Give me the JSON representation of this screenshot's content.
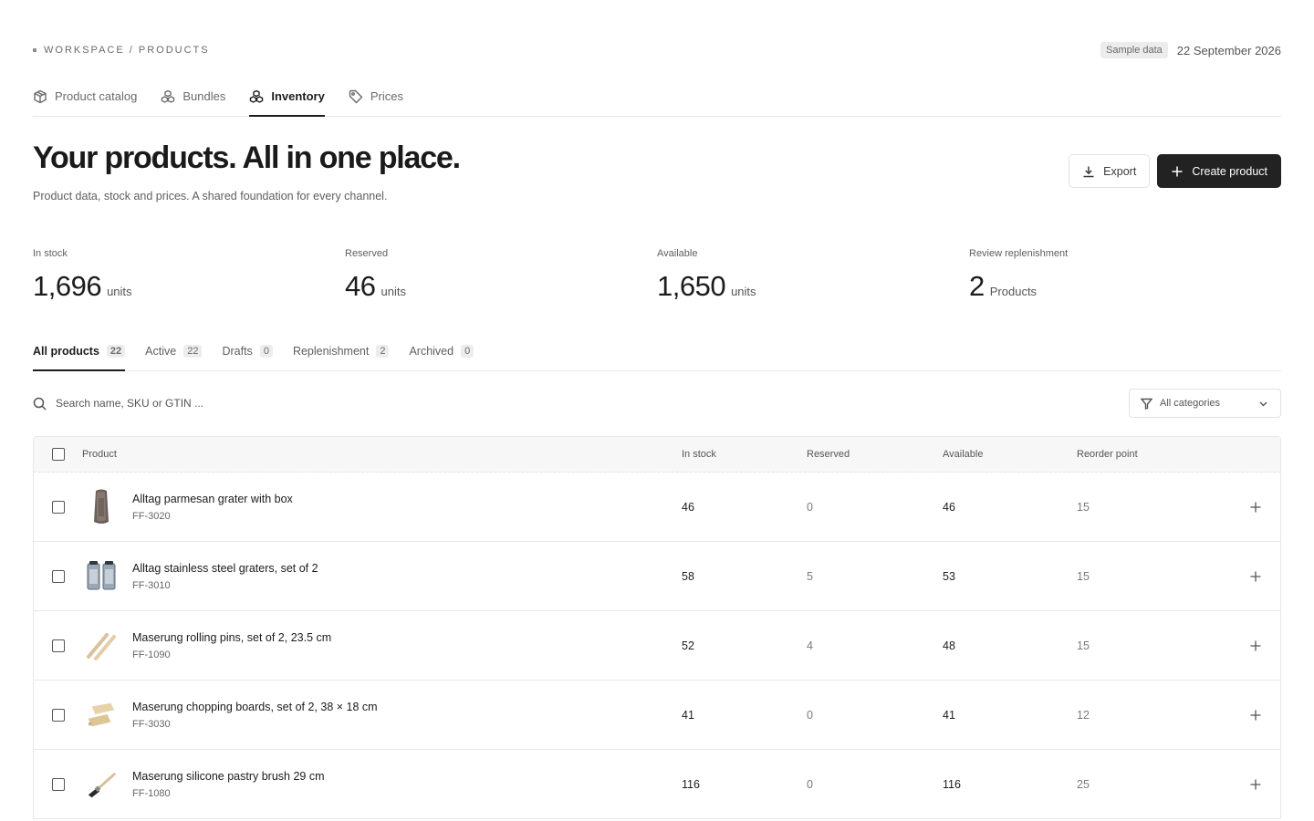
{
  "breadcrumb": {
    "path": "WORKSPACE / PRODUCTS"
  },
  "header": {
    "badge": "Sample data",
    "date": "22 September 2026"
  },
  "nav_tabs": [
    {
      "label": "Product catalog",
      "icon": "box-icon",
      "active": false
    },
    {
      "label": "Bundles",
      "icon": "bundles-icon",
      "active": false
    },
    {
      "label": "Inventory",
      "icon": "inventory-icon",
      "active": true
    },
    {
      "label": "Prices",
      "icon": "tag-icon",
      "active": false
    }
  ],
  "hero": {
    "title": "Your products. All in one place.",
    "subtitle": "Product data, stock and prices. A shared foundation for every channel."
  },
  "actions": {
    "export_label": "Export",
    "create_label": "Create product"
  },
  "stats": [
    {
      "label": "In stock",
      "value": "1,696",
      "unit": "units"
    },
    {
      "label": "Reserved",
      "value": "46",
      "unit": "units"
    },
    {
      "label": "Available",
      "value": "1,650",
      "unit": "units"
    },
    {
      "label": "Review replenishment",
      "value": "2",
      "unit": "Products"
    }
  ],
  "filter_tabs": [
    {
      "label": "All products",
      "count": "22",
      "active": true
    },
    {
      "label": "Active",
      "count": "22",
      "active": false
    },
    {
      "label": "Drafts",
      "count": "0",
      "active": false
    },
    {
      "label": "Replenishment",
      "count": "2",
      "active": false
    },
    {
      "label": "Archived",
      "count": "0",
      "active": false
    }
  ],
  "search": {
    "placeholder": "Search name, SKU or GTIN ..."
  },
  "category_filter": {
    "selected": "All categories"
  },
  "table": {
    "columns": {
      "product": "Product",
      "in_stock": "In stock",
      "reserved": "Reserved",
      "available": "Available",
      "reorder_point": "Reorder point"
    },
    "rows": [
      {
        "name": "Alltag parmesan grater with box",
        "sku": "FF-3020",
        "in_stock": "46",
        "reserved": "0",
        "available": "46",
        "reorder_point": "15",
        "thumb": "grater-box"
      },
      {
        "name": "Alltag stainless steel graters, set of 2",
        "sku": "FF-3010",
        "in_stock": "58",
        "reserved": "5",
        "available": "53",
        "reorder_point": "15",
        "thumb": "graters"
      },
      {
        "name": "Maserung rolling pins, set of 2, 23.5 cm",
        "sku": "FF-1090",
        "in_stock": "52",
        "reserved": "4",
        "available": "48",
        "reorder_point": "15",
        "thumb": "rolling-pins"
      },
      {
        "name": "Maserung chopping boards, set of 2, 38 × 18 cm",
        "sku": "FF-3030",
        "in_stock": "41",
        "reserved": "0",
        "available": "41",
        "reorder_point": "12",
        "thumb": "boards"
      },
      {
        "name": "Maserung silicone pastry brush 29 cm",
        "sku": "FF-1080",
        "in_stock": "116",
        "reserved": "0",
        "available": "116",
        "reorder_point": "25",
        "thumb": "brush"
      }
    ]
  }
}
